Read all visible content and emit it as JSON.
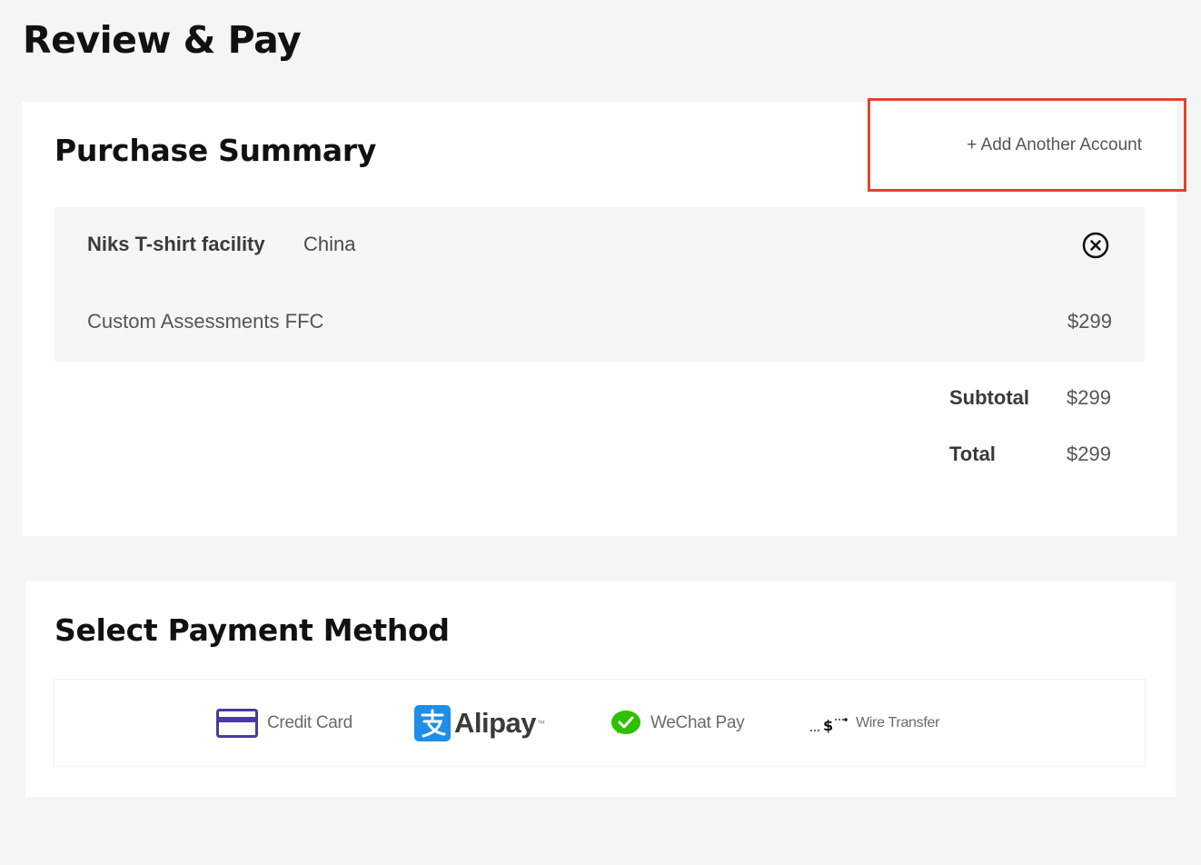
{
  "page": {
    "title": "Review & Pay"
  },
  "purchase_summary": {
    "title": "Purchase Summary",
    "add_account_label": "+ Add Another Account",
    "item": {
      "name": "Niks T-shirt facility",
      "country": "China",
      "description": "Custom Assessments FFC",
      "price": "$299"
    },
    "subtotal": {
      "label": "Subtotal",
      "value": "$299"
    },
    "total": {
      "label": "Total",
      "value": "$299"
    }
  },
  "payment": {
    "title": "Select Payment Method",
    "methods": [
      {
        "label": "Credit Card",
        "icon": "credit-card-icon"
      },
      {
        "label": "Alipay",
        "icon": "alipay-icon"
      },
      {
        "label": "WeChat Pay",
        "icon": "wechat-icon"
      },
      {
        "label": "Wire Transfer",
        "icon": "wire-transfer-icon"
      }
    ]
  },
  "colors": {
    "highlight": "#e0442c",
    "alipay_blue": "#1f8ee6",
    "wechat_green": "#2dc100",
    "credit_card_purple": "#4b3a9e"
  }
}
